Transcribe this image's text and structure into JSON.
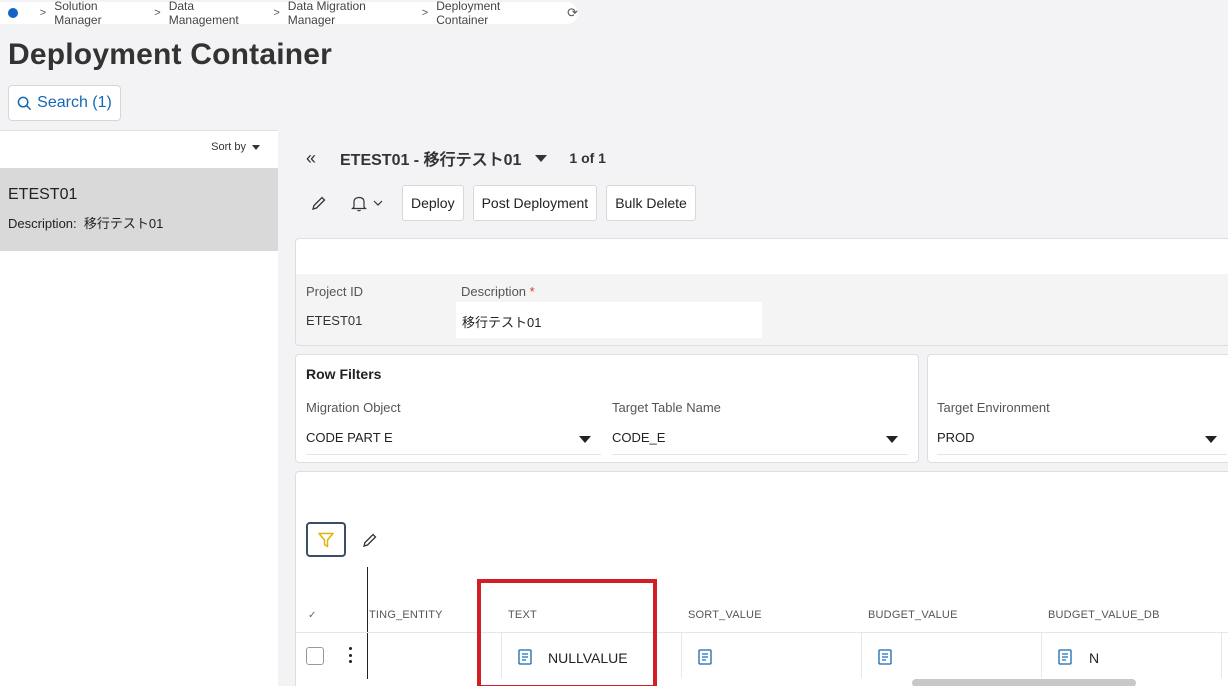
{
  "breadcrumb": {
    "items": [
      "Solution Manager",
      "Data Management",
      "Data Migration Manager",
      "Deployment Container"
    ]
  },
  "page": {
    "title": "Deployment Container"
  },
  "search": {
    "label": "Search (1)"
  },
  "list": {
    "sort_label": "Sort by",
    "item": {
      "title": "ETEST01",
      "description_label": "Description:",
      "description_value": "移行テスト01"
    }
  },
  "record": {
    "title": "ETEST01 - 移行テスト01",
    "count": "1 of 1"
  },
  "toolbar": {
    "deploy": "Deploy",
    "post_deployment": "Post Deployment",
    "bulk_delete": "Bulk Delete"
  },
  "project": {
    "id_label": "Project ID",
    "id_value": "ETEST01",
    "desc_label": "Description",
    "required_mark": "*",
    "desc_value": "移行テスト01"
  },
  "row_filters": {
    "title": "Row Filters",
    "migration_object_label": "Migration Object",
    "migration_object_value": "CODE PART E",
    "target_table_label": "Target Table Name",
    "target_table_value": "CODE_E"
  },
  "target_env": {
    "label": "Target Environment",
    "value": "PROD"
  },
  "grid": {
    "columns": [
      "TING_ENTITY",
      "TEXT",
      "SORT_VALUE",
      "BUDGET_VALUE",
      "BUDGET_VALUE_DB"
    ],
    "row": {
      "text": "NULLVALUE",
      "budget_value_db": "N"
    }
  },
  "colors": {
    "accent": "#1569b2",
    "highlight": "#d11f25",
    "filter_icon": "#e0b400"
  }
}
